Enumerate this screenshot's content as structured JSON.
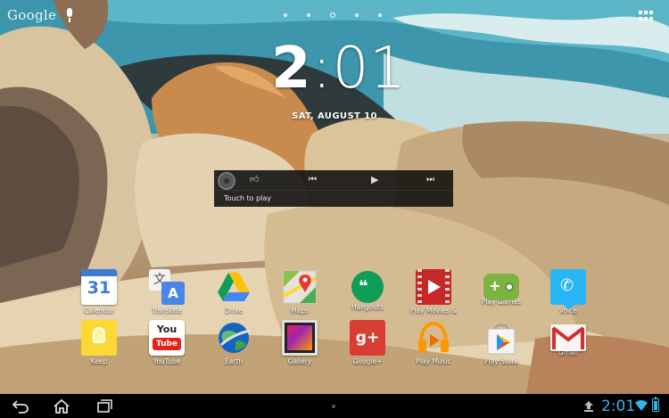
{
  "top_bar": {
    "search_label": "Google",
    "page_count": 5,
    "active_page": 3
  },
  "clock": {
    "hour": "2",
    "minutes": ":01",
    "date": "SAT, AUGUST 10"
  },
  "music_widget": {
    "status": "Touch to play"
  },
  "apps": [
    {
      "label": "Calendar",
      "icon": "calendar-icon"
    },
    {
      "label": "Translate",
      "icon": "translate-icon"
    },
    {
      "label": "Drive",
      "icon": "drive-icon"
    },
    {
      "label": "Maps",
      "icon": "maps-icon"
    },
    {
      "label": "Hangouts",
      "icon": "hangouts-icon"
    },
    {
      "label": "Play Movies &",
      "icon": "play-movies-icon"
    },
    {
      "label": "Play Games",
      "icon": "play-games-icon"
    },
    {
      "label": "Voice",
      "icon": "voice-icon"
    },
    {
      "label": "Keep",
      "icon": "keep-icon"
    },
    {
      "label": "YouTube",
      "icon": "youtube-icon"
    },
    {
      "label": "Earth",
      "icon": "earth-icon"
    },
    {
      "label": "Gallery",
      "icon": "gallery-icon"
    },
    {
      "label": "Google+",
      "icon": "google-plus-icon"
    },
    {
      "label": "Play Music",
      "icon": "play-music-icon"
    },
    {
      "label": "Play Store",
      "icon": "play-store-icon"
    },
    {
      "label": "Gmail",
      "icon": "gmail-icon"
    }
  ],
  "icon_text": {
    "calendar_day": "31",
    "translate_a": "文",
    "translate_b": "A",
    "hangouts_mark": "❝",
    "voice_mark": "✆",
    "youtube_you": "You",
    "youtube_tube": "Tube",
    "gplus_mark": "g+"
  },
  "status_bar": {
    "time": "2:01",
    "accent_color": "#33b5e5"
  }
}
